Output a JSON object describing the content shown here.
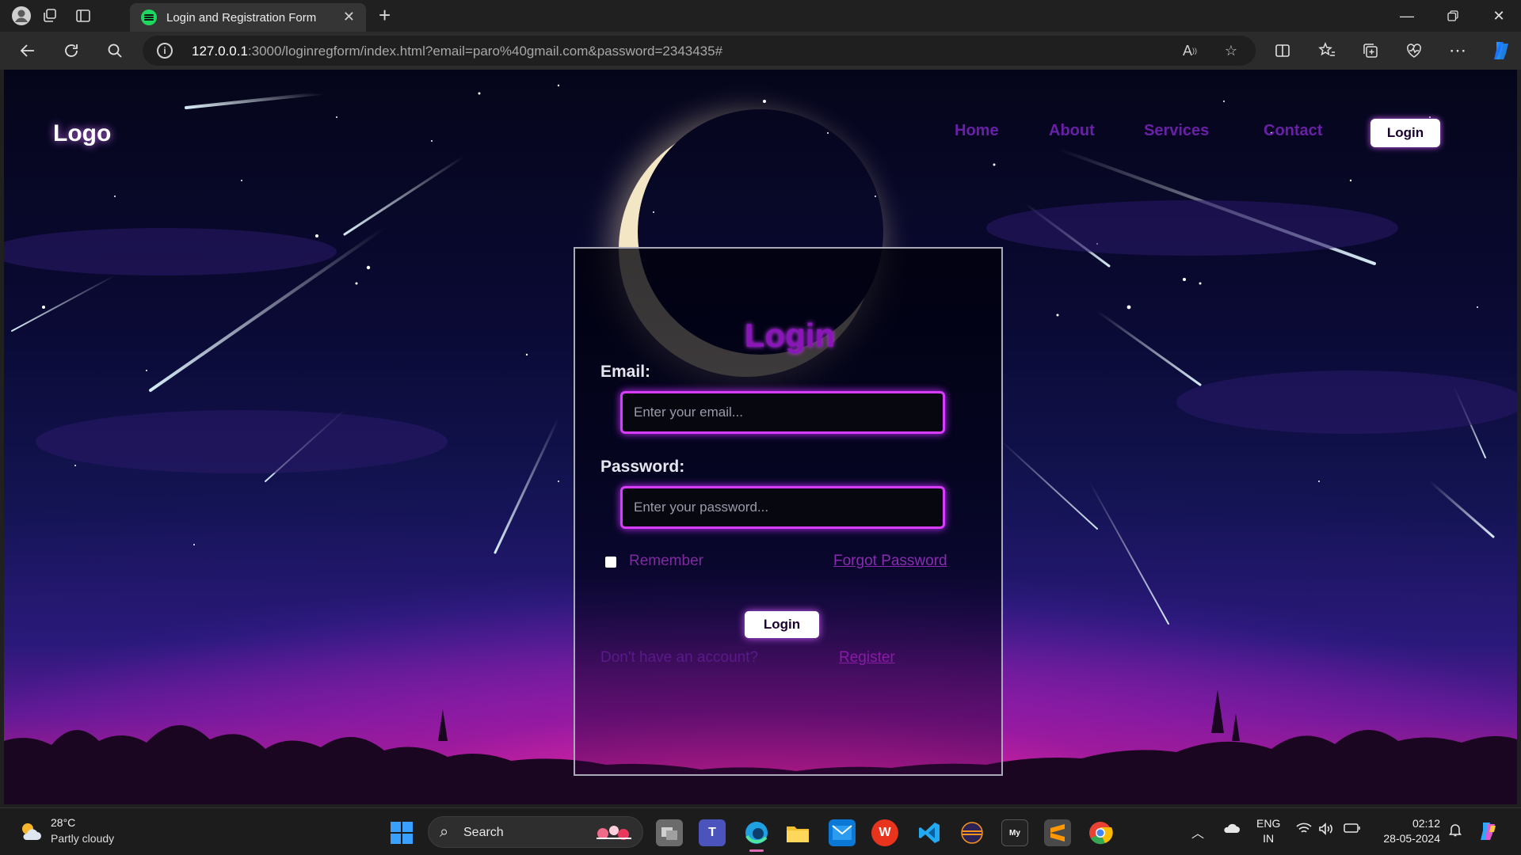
{
  "browser": {
    "tab_title": "Login and Registration Form",
    "url_host": "127.0.0.1",
    "url_rest": ":3000/loginregform/index.html?email=paro%40gmail.com&password=2343435#"
  },
  "site": {
    "logo": "Logo",
    "nav": [
      "Home",
      "About",
      "Services",
      "Contact"
    ],
    "nav_login": "Login"
  },
  "form": {
    "title": "Login",
    "email_label": "Email:",
    "email_placeholder": "Enter your email...",
    "password_label": "Password:",
    "password_placeholder": "Enter your password...",
    "remember": "Remember",
    "forgot": "Forgot Password",
    "submit": "Login",
    "no_account": "Don't have an account?",
    "register": "Register"
  },
  "taskbar": {
    "temperature": "28°C",
    "weather": "Partly cloudy",
    "search": "Search",
    "lang": "ENG",
    "region": "IN",
    "time": "02:12",
    "date": "28-05-2024"
  },
  "colors": {
    "accent": "#d83cff",
    "nav_link": "#6a1fa8",
    "title": "#8a16b8"
  }
}
